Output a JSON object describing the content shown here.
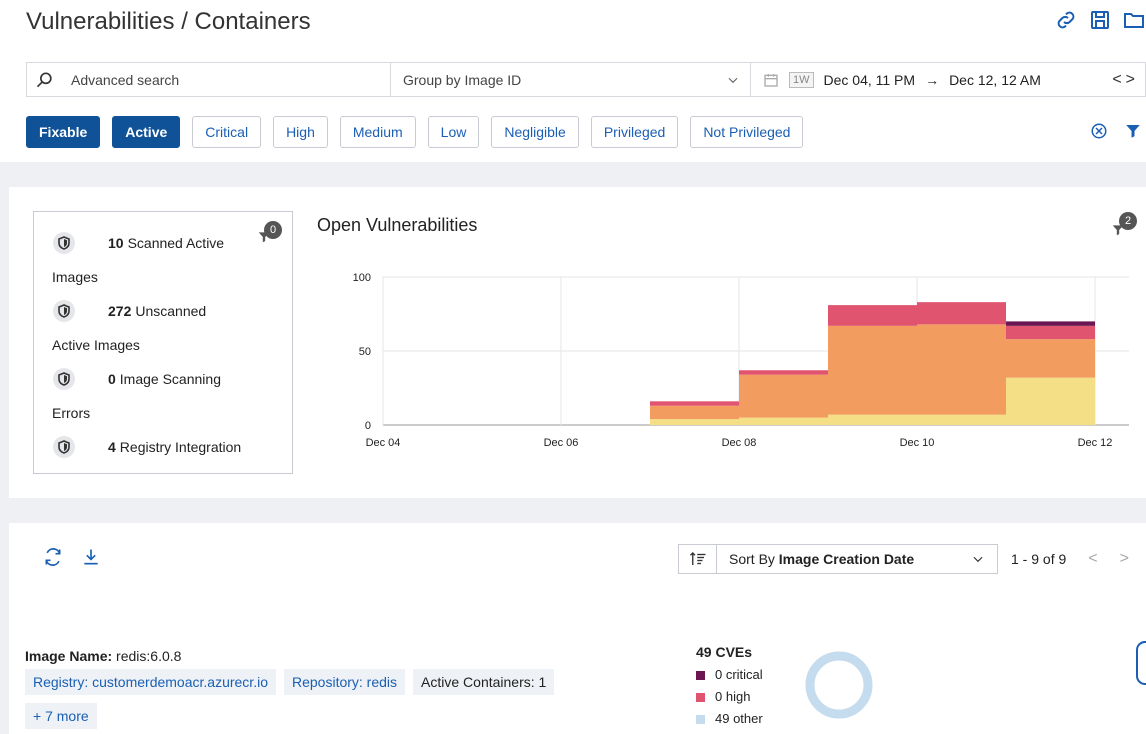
{
  "header": {
    "title": "Vulnerabilities / Containers"
  },
  "search": {
    "advanced_label": "Advanced search",
    "group_by": "Group by Image ID",
    "range_badge": "1W",
    "date_from": "Dec 04, 11 PM",
    "arrow": "→",
    "date_to": "Dec 12, 12 AM"
  },
  "filters": [
    {
      "label": "Fixable",
      "active": true
    },
    {
      "label": "Active",
      "active": true
    },
    {
      "label": "Critical",
      "active": false
    },
    {
      "label": "High",
      "active": false
    },
    {
      "label": "Medium",
      "active": false
    },
    {
      "label": "Low",
      "active": false
    },
    {
      "label": "Negligible",
      "active": false
    },
    {
      "label": "Privileged",
      "active": false
    },
    {
      "label": "Not Privileged",
      "active": false
    }
  ],
  "summary": {
    "badge": "0",
    "items": [
      {
        "count": "10",
        "line1": "Scanned Active",
        "line2": "Images"
      },
      {
        "count": "272",
        "line1": "Unscanned",
        "line2": "Active Images"
      },
      {
        "count": "0",
        "line1": "Image Scanning",
        "line2": "Errors"
      },
      {
        "count": "4",
        "line1": "Registry Integration",
        "line2": ""
      }
    ]
  },
  "chart": {
    "title": "Open Vulnerabilities",
    "badge": "2"
  },
  "chart_data": {
    "type": "bar",
    "stacked": true,
    "title": "Open Vulnerabilities",
    "x_tick_labels": [
      "Dec 04",
      "Dec 06",
      "Dec 08",
      "Dec 10",
      "Dec 12"
    ],
    "y_ticks": [
      0,
      50,
      100
    ],
    "ylim": [
      0,
      100
    ],
    "grid": true,
    "bars": [
      {
        "start_day": 7,
        "end_day": 8,
        "series": [
          4,
          9,
          3,
          0
        ]
      },
      {
        "start_day": 8,
        "end_day": 9,
        "series": [
          5,
          29,
          3,
          0
        ]
      },
      {
        "start_day": 9,
        "end_day": 10,
        "series": [
          7,
          60,
          14,
          0
        ]
      },
      {
        "start_day": 10,
        "end_day": 11,
        "series": [
          7,
          61,
          15,
          0
        ]
      },
      {
        "start_day": 11,
        "end_day": 12,
        "series": [
          32,
          26,
          9,
          3
        ]
      }
    ],
    "series_colors": [
      "#f4df86",
      "#f39c5f",
      "#e05470",
      "#6b1552"
    ]
  },
  "list": {
    "sort_prefix": "Sort By ",
    "sort_field": "Image Creation Date",
    "pager_text": "1 - 9 of 9",
    "image_name_label": "Image Name:",
    "image_name_value": " redis:6.0.8",
    "tag_registry": "Registry: customerdemoacr.azurecr.io",
    "tag_repository": "Repository: redis",
    "tag_containers": "Active Containers: 1",
    "more": "+ 7 more",
    "cves_title": "49 CVEs",
    "legend": [
      {
        "label": "0 critical",
        "color": "#6b1552"
      },
      {
        "label": "0 high",
        "color": "#e05470"
      },
      {
        "label": "49 other",
        "color": "#c5dbee"
      }
    ]
  }
}
